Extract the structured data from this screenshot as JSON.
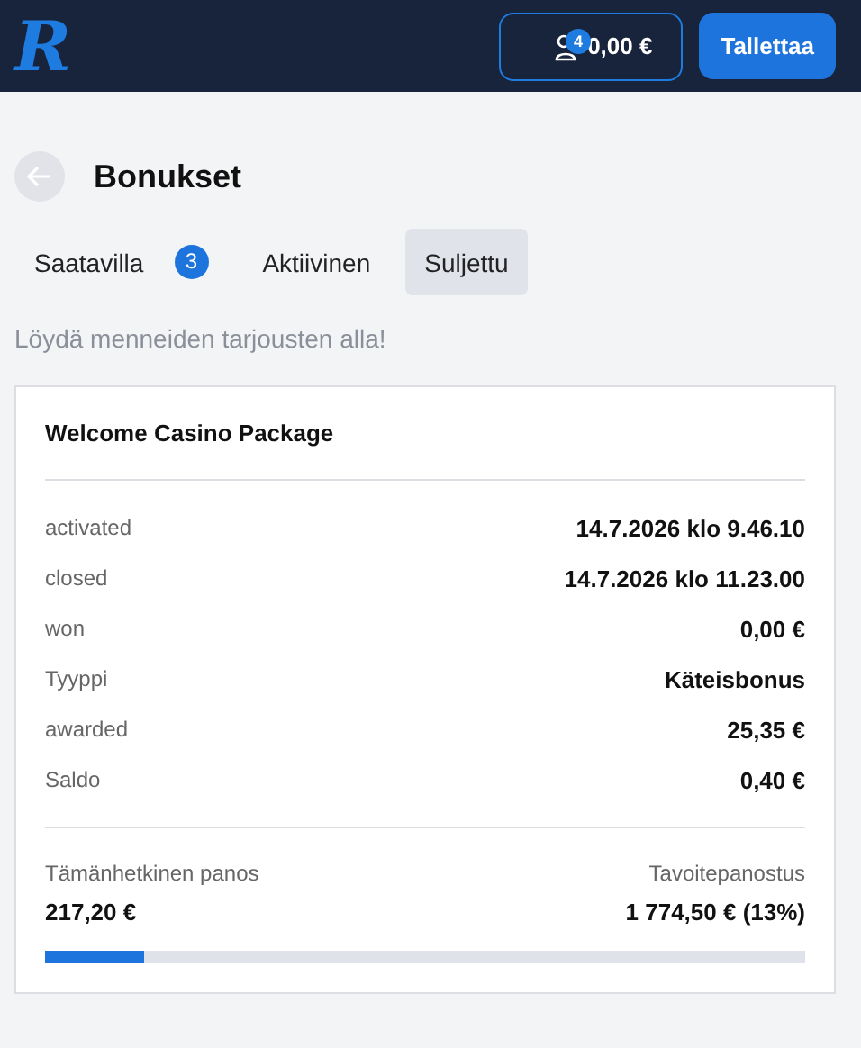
{
  "header": {
    "logo": "R",
    "balance": {
      "badge": "4",
      "amount": "0,00 €"
    },
    "deposit_button": "Tallettaa"
  },
  "page": {
    "title": "Bonukset"
  },
  "tabs": [
    {
      "label": "Saatavilla",
      "count": "3",
      "selected": false
    },
    {
      "label": "Aktiivinen",
      "selected": false
    },
    {
      "label": "Suljettu",
      "selected": true
    }
  ],
  "subtitle": "Löydä menneiden tarjousten alla!",
  "card": {
    "title": "Welcome Casino Package",
    "rows": [
      {
        "label": "activated",
        "value": "14.7.2026 klo 9.46.10"
      },
      {
        "label": "closed",
        "value": "14.7.2026 klo 11.23.00"
      },
      {
        "label": "won",
        "value": "0,00 €"
      },
      {
        "label": "Tyyppi",
        "value": "Käteisbonus"
      },
      {
        "label": "awarded",
        "value": "25,35 €"
      },
      {
        "label": "Saldo",
        "value": "0,40 €"
      }
    ],
    "wager": {
      "current_label": "Tämänhetkinen panos",
      "current_value": "217,20 €",
      "target_label": "Tavoitepanostus",
      "target_value": "1 774,50 € (13%)",
      "level": 0.13
    }
  }
}
